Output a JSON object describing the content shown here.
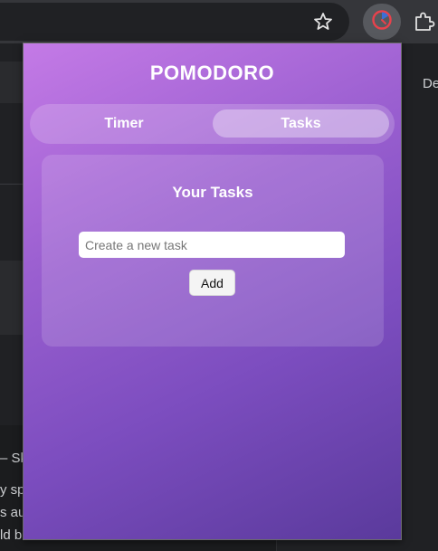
{
  "background_page": {
    "snippets": [
      "De",
      "– Sk",
      "y sp",
      "s au",
      "ld b"
    ]
  },
  "toolbar": {
    "bookmark_icon": "star-icon",
    "active_extension_icon": "timer-icon",
    "extensions_icon": "puzzle-icon",
    "accent": "#e8424c"
  },
  "popup": {
    "title": "POMODORO",
    "tabs": [
      {
        "label": "Timer",
        "active": false
      },
      {
        "label": "Tasks",
        "active": true
      }
    ],
    "tasks_card": {
      "heading": "Your Tasks",
      "input_placeholder": "Create a new task",
      "input_value": "",
      "add_label": "Add"
    },
    "gradient": [
      "#c47ae6",
      "#5a3a9c"
    ]
  }
}
